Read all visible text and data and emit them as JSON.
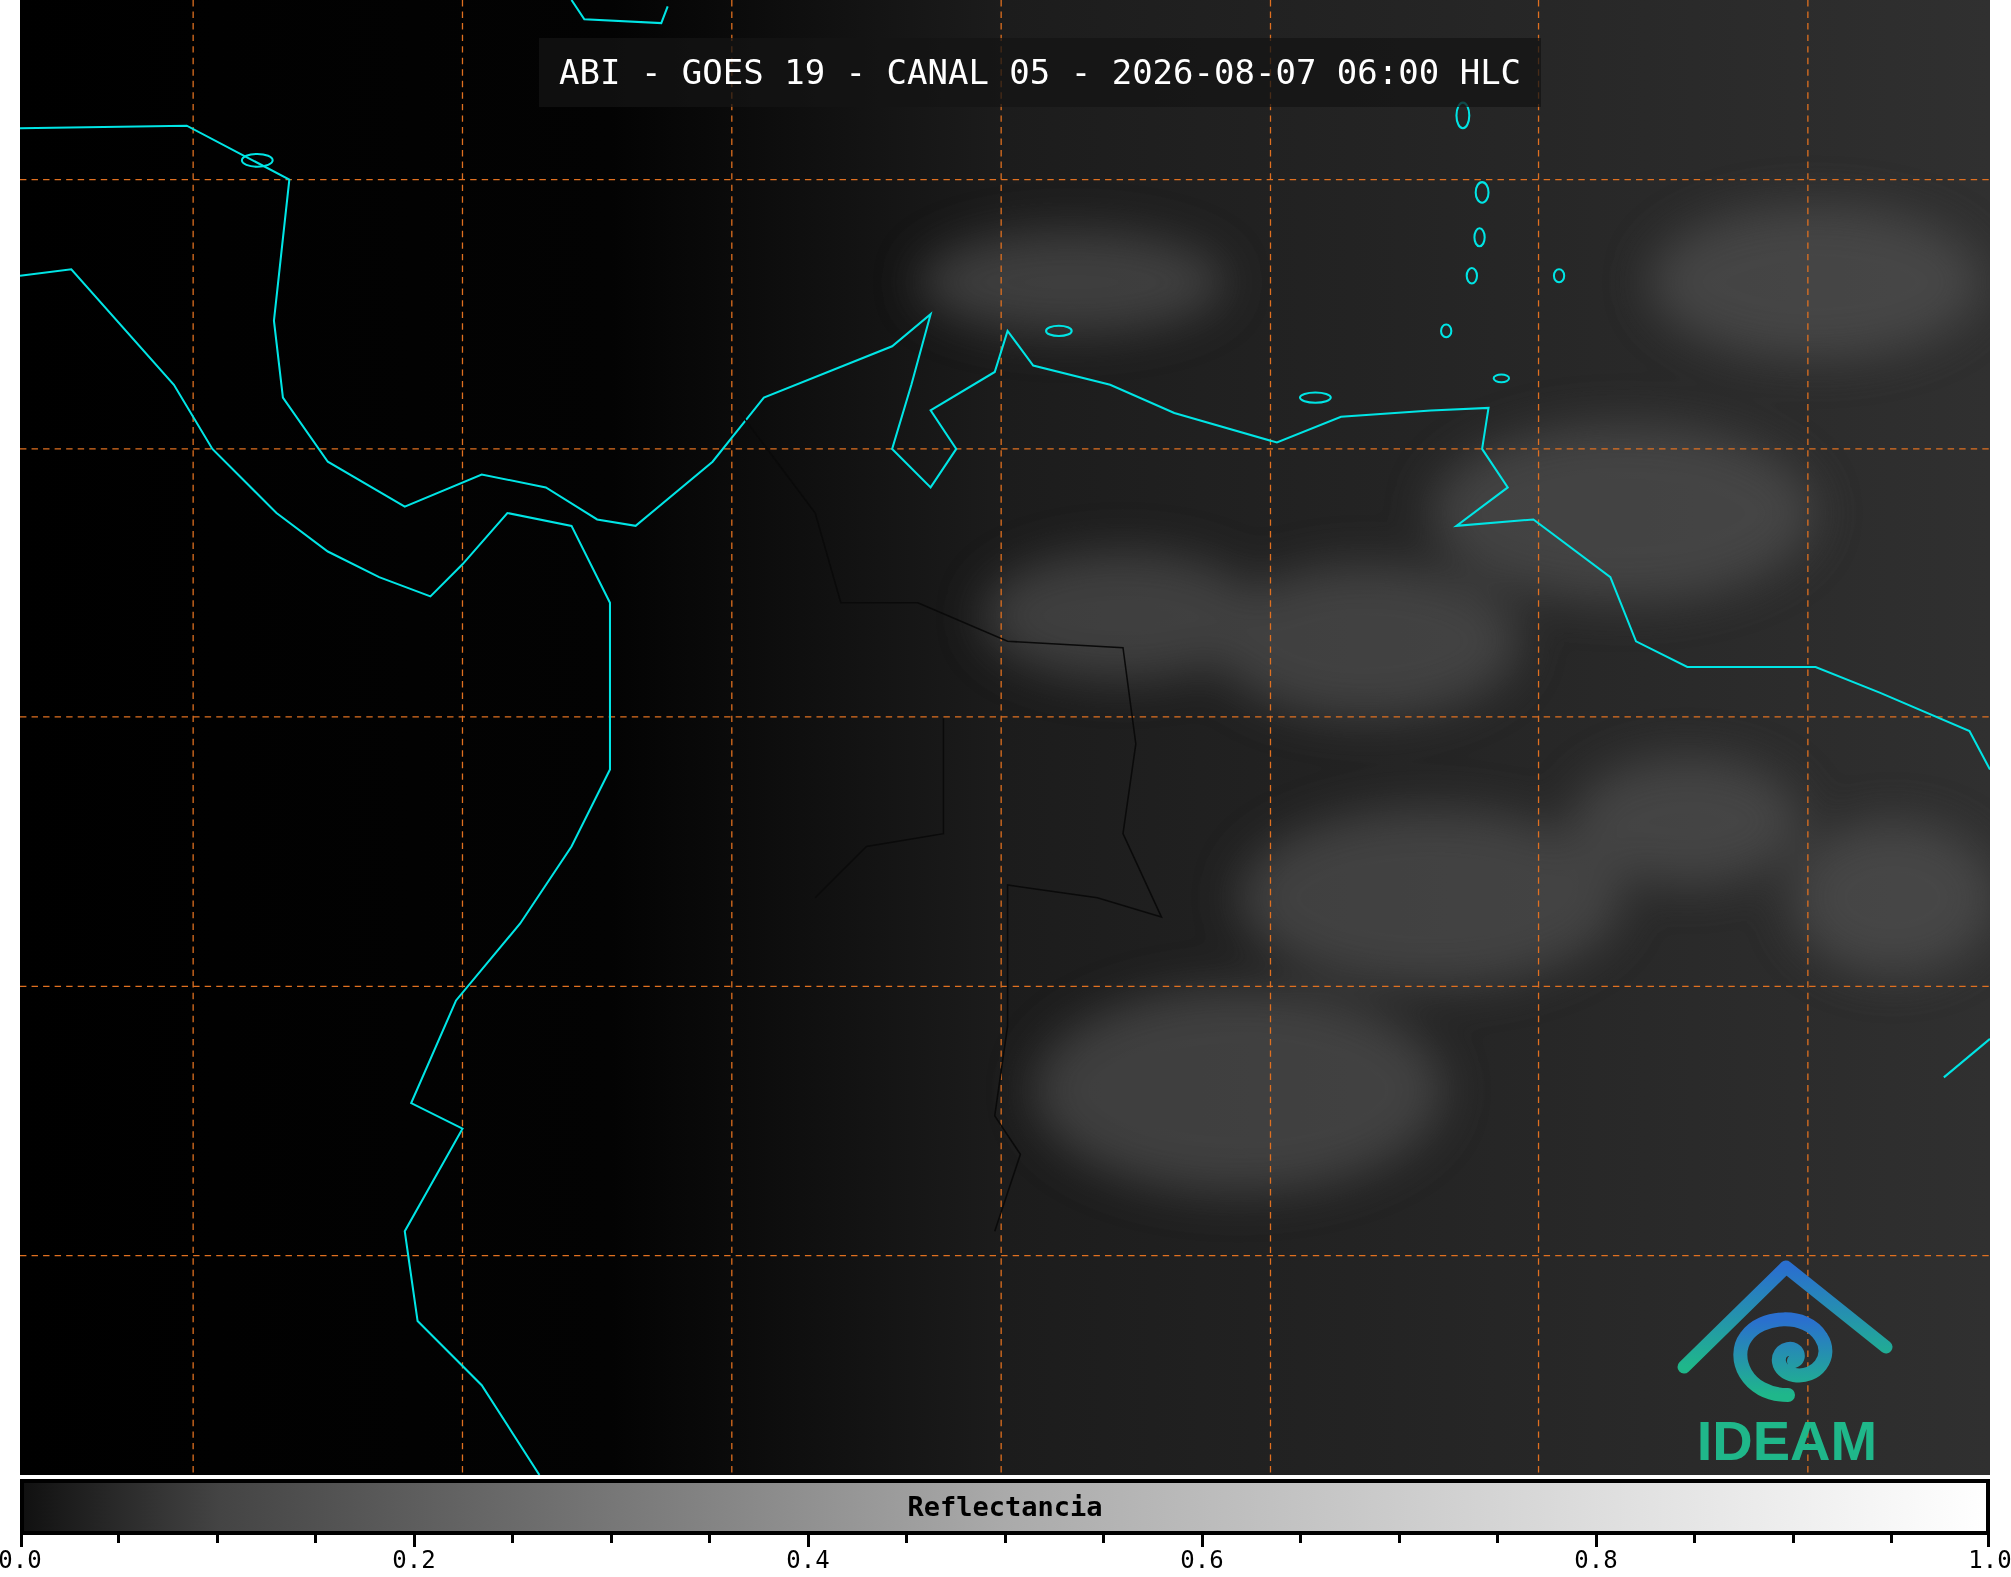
{
  "title": "ABI - GOES 19 - CANAL 05 - 2026-08-07 06:00 HLC",
  "logo": {
    "text": "IDEAM"
  },
  "colorbar": {
    "label": "Reflectancia",
    "tick_labels": [
      "0.0",
      "0.2",
      "0.4",
      "0.6",
      "0.8",
      "1.0"
    ]
  }
}
